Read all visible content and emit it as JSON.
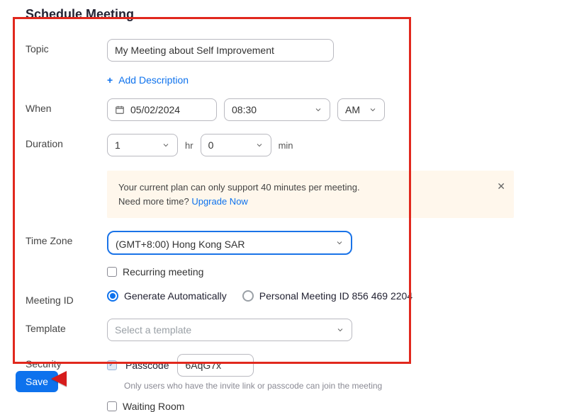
{
  "page": {
    "title": "Schedule Meeting"
  },
  "topic": {
    "label": "Topic",
    "value": "My Meeting about Self Improvement",
    "add_desc": "Add Description"
  },
  "when": {
    "label": "When",
    "date": "05/02/2024",
    "time": "08:30",
    "ampm": "AM"
  },
  "duration": {
    "label": "Duration",
    "hours": "1",
    "hr_unit": "hr",
    "minutes": "0",
    "min_unit": "min"
  },
  "banner": {
    "line1": "Your current plan can only support 40 minutes per meeting.",
    "line2_prefix": "Need more time?  ",
    "upgrade": "Upgrade Now"
  },
  "timezone": {
    "label": "Time Zone",
    "value": "(GMT+8:00) Hong Kong SAR"
  },
  "recurring": {
    "label": "Recurring meeting"
  },
  "meeting_id": {
    "label": "Meeting ID",
    "auto": "Generate Automatically",
    "personal": "Personal Meeting ID 856 469 2204"
  },
  "template": {
    "label": "Template",
    "placeholder": "Select a template"
  },
  "security": {
    "label": "Security",
    "passcode_label": "Passcode",
    "passcode_value": "6AqG7x",
    "helper": "Only users who have the invite link or passcode can join the meeting",
    "waiting_room": "Waiting Room"
  },
  "footer": {
    "save": "Save"
  }
}
